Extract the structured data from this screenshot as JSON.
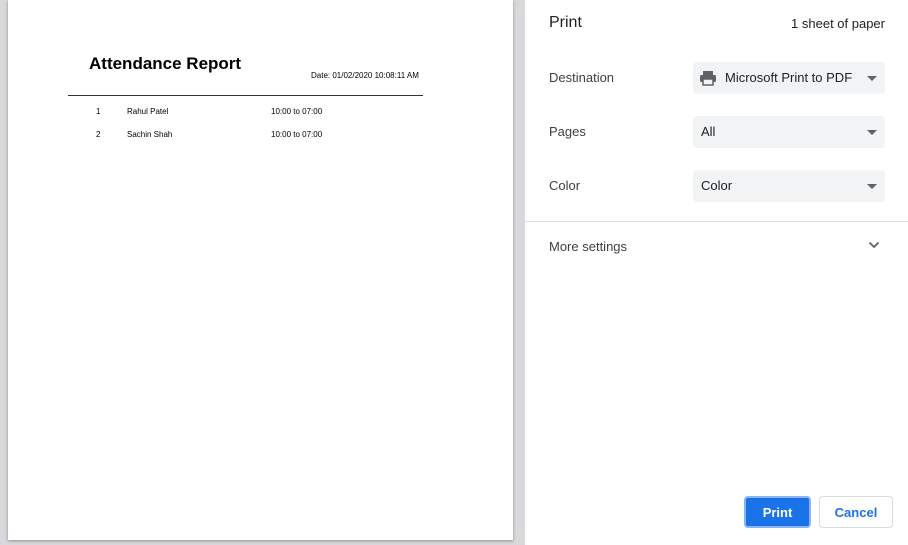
{
  "preview": {
    "report_title": "Attendance Report",
    "report_date": "Date: 01/02/2020 10:08:11 AM",
    "rows": [
      {
        "num": "1",
        "name": "Rahul Patel",
        "time": "10:00 to 07:00"
      },
      {
        "num": "2",
        "name": "Sachin Shah",
        "time": "10:00 to 07:00"
      }
    ]
  },
  "print_panel": {
    "title": "Print",
    "sheet_count": "1 sheet of paper",
    "destination": {
      "label": "Destination",
      "value": "Microsoft Print to PDF",
      "icon": "printer-icon"
    },
    "pages": {
      "label": "Pages",
      "value": "All"
    },
    "color": {
      "label": "Color",
      "value": "Color"
    },
    "more_settings": {
      "label": "More settings",
      "icon": "chevron-down-icon"
    },
    "print_button": "Print",
    "cancel_button": "Cancel"
  },
  "colors": {
    "accent": "#1a73e8",
    "select_bg": "#f1f3f4",
    "preview_bg": "#d9d9dc"
  }
}
